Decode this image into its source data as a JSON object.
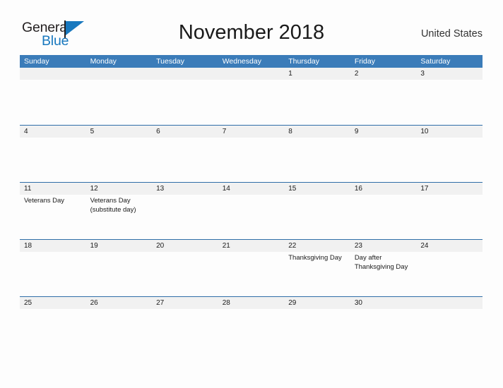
{
  "logo": {
    "part1": "General",
    "part2": "Blue",
    "color_dark": "#231f20",
    "color_blue": "#1878be"
  },
  "header": {
    "title": "November 2018",
    "country": "United States"
  },
  "theme": {
    "header_blue": "#3b7cb9",
    "row_divider_blue": "#2f6ea8",
    "number_band_gray": "#f1f1f1",
    "page_background": "#fdfdfd"
  },
  "calendar": {
    "weekdays": [
      "Sunday",
      "Monday",
      "Tuesday",
      "Wednesday",
      "Thursday",
      "Friday",
      "Saturday"
    ],
    "weeks": [
      {
        "days": [
          {
            "num": "",
            "event": ""
          },
          {
            "num": "",
            "event": ""
          },
          {
            "num": "",
            "event": ""
          },
          {
            "num": "",
            "event": ""
          },
          {
            "num": "1",
            "event": ""
          },
          {
            "num": "2",
            "event": ""
          },
          {
            "num": "3",
            "event": ""
          }
        ]
      },
      {
        "days": [
          {
            "num": "4",
            "event": ""
          },
          {
            "num": "5",
            "event": ""
          },
          {
            "num": "6",
            "event": ""
          },
          {
            "num": "7",
            "event": ""
          },
          {
            "num": "8",
            "event": ""
          },
          {
            "num": "9",
            "event": ""
          },
          {
            "num": "10",
            "event": ""
          }
        ]
      },
      {
        "days": [
          {
            "num": "11",
            "event": "Veterans Day"
          },
          {
            "num": "12",
            "event": "Veterans Day (substitute day)"
          },
          {
            "num": "13",
            "event": ""
          },
          {
            "num": "14",
            "event": ""
          },
          {
            "num": "15",
            "event": ""
          },
          {
            "num": "16",
            "event": ""
          },
          {
            "num": "17",
            "event": ""
          }
        ]
      },
      {
        "days": [
          {
            "num": "18",
            "event": ""
          },
          {
            "num": "19",
            "event": ""
          },
          {
            "num": "20",
            "event": ""
          },
          {
            "num": "21",
            "event": ""
          },
          {
            "num": "22",
            "event": "Thanksgiving Day"
          },
          {
            "num": "23",
            "event": "Day after Thanksgiving Day"
          },
          {
            "num": "24",
            "event": ""
          }
        ]
      },
      {
        "days": [
          {
            "num": "25",
            "event": ""
          },
          {
            "num": "26",
            "event": ""
          },
          {
            "num": "27",
            "event": ""
          },
          {
            "num": "28",
            "event": ""
          },
          {
            "num": "29",
            "event": ""
          },
          {
            "num": "30",
            "event": ""
          },
          {
            "num": "",
            "event": ""
          }
        ]
      }
    ]
  }
}
